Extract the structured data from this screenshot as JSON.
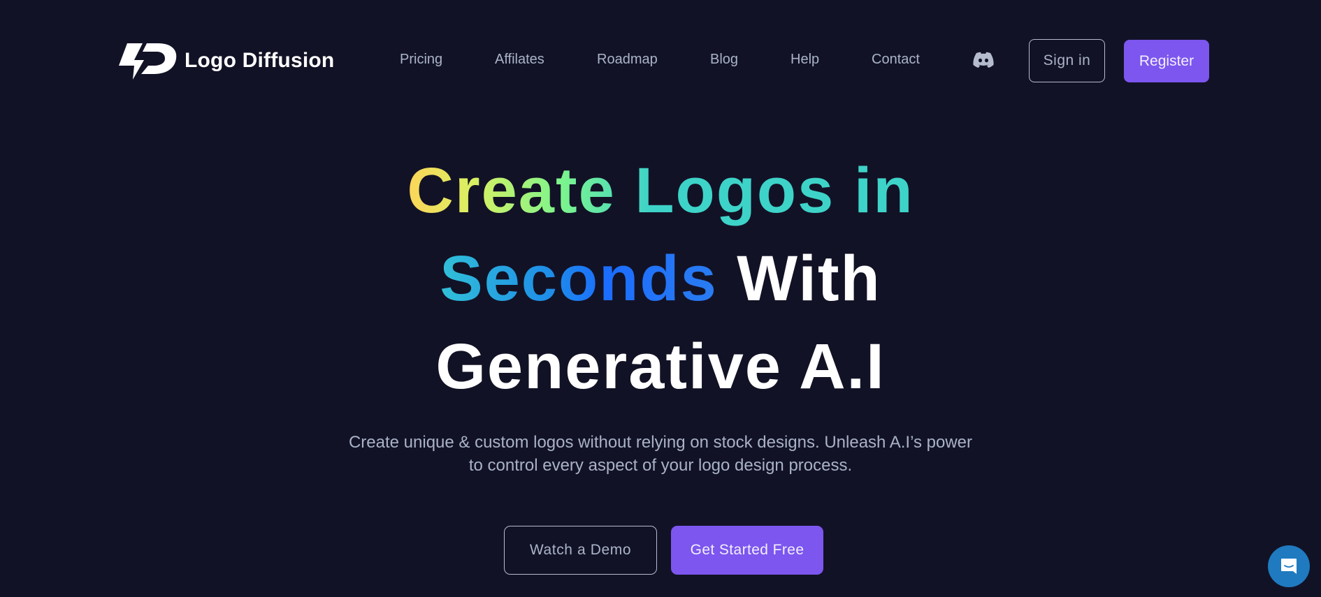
{
  "header": {
    "brand": "Logo Diffusion",
    "nav": [
      {
        "label": "Pricing"
      },
      {
        "label": "Affilates"
      },
      {
        "label": "Roadmap"
      },
      {
        "label": "Blog"
      },
      {
        "label": "Help"
      },
      {
        "label": "Contact"
      }
    ],
    "discord_icon": "discord-icon",
    "signin_label": "Sign in",
    "register_label": "Register"
  },
  "hero": {
    "title_gradient_1": "Create Logos in",
    "title_gradient_2": "Seconds",
    "title_white_1": "With",
    "title_white_2": "Generative A.I",
    "subtitle_line_1": "Create unique & custom logos without relying on stock designs. Unleash A.I’s power",
    "subtitle_line_2": "to control every aspect of your logo design process.",
    "demo_label": "Watch a Demo",
    "start_label": "Get Started Free"
  },
  "colors": {
    "background": "#121226",
    "accent": "#7c56ee",
    "nav_text": "#aab4c8",
    "chat_bubble": "#1f7ac0"
  },
  "chat": {
    "icon": "chat-icon"
  }
}
